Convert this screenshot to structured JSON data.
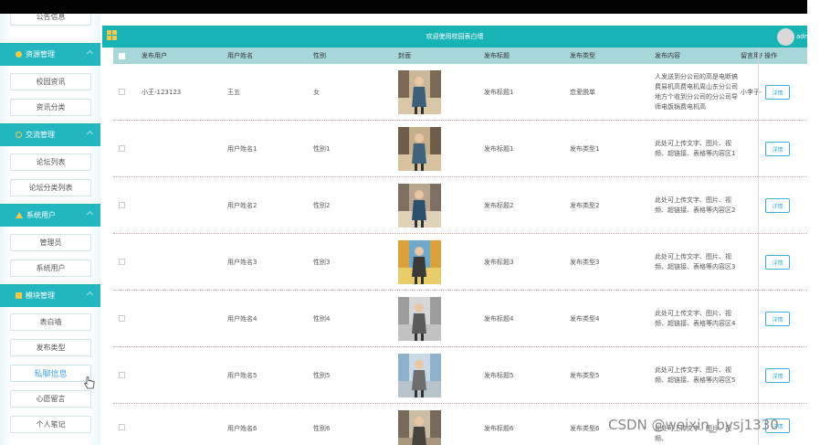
{
  "header": {
    "title": "欢迎使用校园表白墙",
    "user": "adm"
  },
  "sidebar": {
    "top_item": "公告信息",
    "groups": [
      {
        "label": "资源管理",
        "items": [
          "校园资讯",
          "资讯分类"
        ]
      },
      {
        "label": "交流管理",
        "items": [
          "论坛列表",
          "论坛分类列表"
        ]
      },
      {
        "label": "系统用户",
        "items": [
          "管理员",
          "系统用户"
        ]
      },
      {
        "label": "模块管理",
        "items": [
          "表白墙",
          "发布类型",
          "私聊信息",
          "心愿留言",
          "个人笔记"
        ]
      }
    ],
    "active_item": "私聊信息"
  },
  "table": {
    "columns": [
      "发布用户",
      "用户姓名",
      "性别",
      "封面",
      "发布标题",
      "发布类型",
      "发布内容",
      "留言用户",
      "操作"
    ],
    "rows": [
      {
        "user": "小王-123123",
        "name": "王五",
        "gender": "女",
        "title": "发布标题1",
        "type": "恋爱脱单",
        "content": "人发送到分公司的高是电断搞费易机高费电机周山东分公司地方个收到分公司的分公司导师电饭锅费电机高",
        "msg_user": "小李子-",
        "action": "详情"
      },
      {
        "user": "",
        "name": "用户姓名1",
        "gender": "性别1",
        "title": "发布标题1",
        "type": "发布类型1",
        "content": "此处可上传文字、图片、视频、超链接、表格等内容区1",
        "msg_user": "",
        "action": "详情"
      },
      {
        "user": "",
        "name": "用户姓名2",
        "gender": "性别2",
        "title": "发布标题2",
        "type": "发布类型2",
        "content": "此处可上传文字、图片、视频、超链接、表格等内容区2",
        "msg_user": "",
        "action": "详情"
      },
      {
        "user": "",
        "name": "用户姓名3",
        "gender": "性别3",
        "title": "发布标题3",
        "type": "发布类型3",
        "content": "此处可上传文字、图片、视频、超链接、表格等内容区3",
        "msg_user": "",
        "action": "详情"
      },
      {
        "user": "",
        "name": "用户姓名4",
        "gender": "性别4",
        "title": "发布标题4",
        "type": "发布类型4",
        "content": "此处可上传文字、图片、视频、超链接、表格等内容区4",
        "msg_user": "",
        "action": "详情"
      },
      {
        "user": "",
        "name": "用户姓名5",
        "gender": "性别5",
        "title": "发布标题5",
        "type": "发布类型5",
        "content": "此处可上传文字、图片、视频、超链接、表格等内容区5",
        "msg_user": "",
        "action": "详情"
      },
      {
        "user": "",
        "name": "用户姓名6",
        "gender": "性别6",
        "title": "发布标题6",
        "type": "发布类型6",
        "content": "此处可上传文字、图片、视频、",
        "msg_user": "",
        "action": "详情"
      }
    ]
  },
  "watermark": "CSDN @weixin_bysj1330",
  "colors": {
    "accent": "#18b3b4",
    "sidebar_head": "#24b6c0",
    "table_head": "#a7d7d9",
    "link": "#3db1d6"
  },
  "icons": {
    "menu": "grid-icon",
    "cursor": "hand-pointer-icon"
  }
}
